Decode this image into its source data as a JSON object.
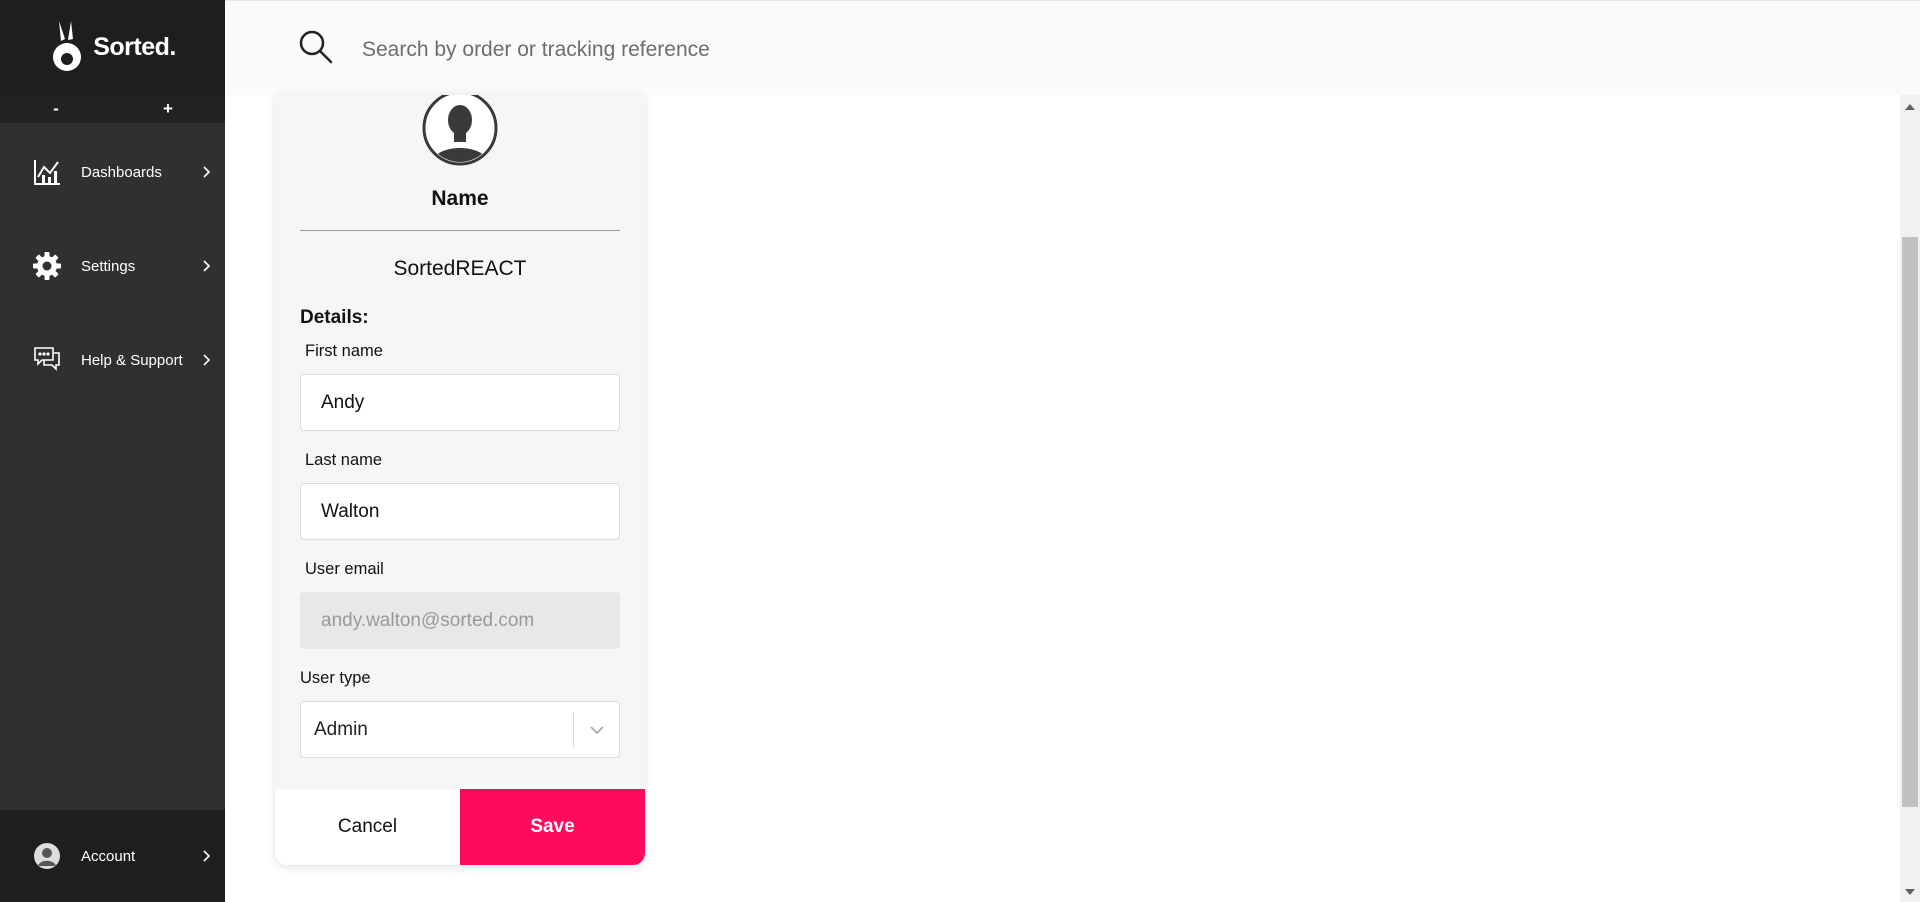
{
  "sidebar": {
    "logo_text": "Sorted.",
    "zoom_out_label": "-",
    "zoom_in_label": "+",
    "items": [
      {
        "label": "Dashboards",
        "icon": "chart-icon"
      },
      {
        "label": "Settings",
        "icon": "gear-icon"
      },
      {
        "label": "Help & Support",
        "icon": "chat-icon"
      }
    ],
    "account": {
      "label": "Account",
      "icon": "user-icon"
    }
  },
  "search": {
    "placeholder": "Search by order or tracking reference",
    "value": ""
  },
  "profile_card": {
    "name_heading": "Name",
    "company": "SortedREACT",
    "details_title": "Details:",
    "first_name": {
      "label": "First name",
      "value": "Andy"
    },
    "last_name": {
      "label": "Last name",
      "value": "Walton"
    },
    "email": {
      "label": "User email",
      "value": "andy.walton@sorted.com"
    },
    "user_type": {
      "label": "User type",
      "value": "Admin"
    },
    "cancel_label": "Cancel",
    "save_label": "Save"
  },
  "colors": {
    "sidebar_bg": "#303030",
    "sidebar_dark": "#1e1e1e",
    "accent": "#ff0a5c",
    "card_bg": "#f6f6f6"
  }
}
